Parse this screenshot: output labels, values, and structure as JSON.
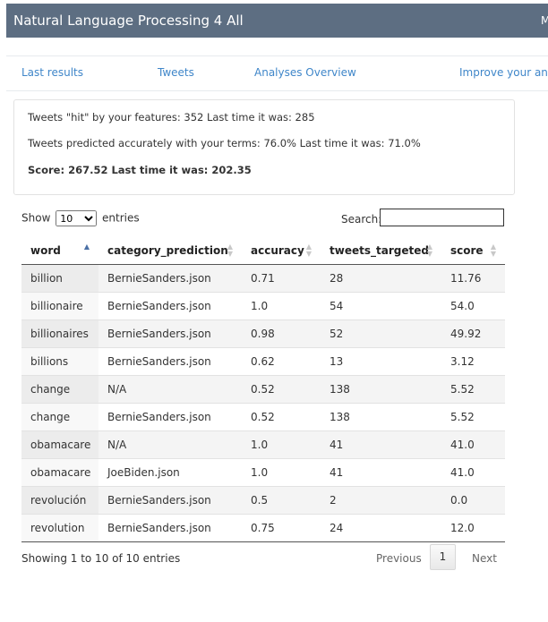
{
  "navbar": {
    "title": "Natural Language Processing 4 All",
    "extra": "M"
  },
  "tabs": [
    {
      "label": "Last results"
    },
    {
      "label": "Tweets"
    },
    {
      "label": "Analyses Overview"
    },
    {
      "label": "Improve your analy"
    }
  ],
  "summary": {
    "hit_line": "Tweets \"hit\" by your features: 352 Last time it was: 285",
    "accuracy_line": "Tweets predicted accurately with your terms: 76.0% Last time it was: 71.0%",
    "score_line": "Score: 267.52 Last time it was: 202.35"
  },
  "controls": {
    "show_label": "Show",
    "entries_value": "10",
    "entries_label": "entries",
    "search_label": "Search:",
    "search_value": ""
  },
  "table": {
    "columns": [
      "word",
      "category_prediction",
      "accuracy",
      "tweets_targeted",
      "score"
    ],
    "rows": [
      [
        "billion",
        "BernieSanders.json",
        "0.71",
        "28",
        "11.76"
      ],
      [
        "billionaire",
        "BernieSanders.json",
        "1.0",
        "54",
        "54.0"
      ],
      [
        "billionaires",
        "BernieSanders.json",
        "0.98",
        "52",
        "49.92"
      ],
      [
        "billions",
        "BernieSanders.json",
        "0.62",
        "13",
        "3.12"
      ],
      [
        "change",
        "N/A",
        "0.52",
        "138",
        "5.52"
      ],
      [
        "change",
        "BernieSanders.json",
        "0.52",
        "138",
        "5.52"
      ],
      [
        "obamacare",
        "N/A",
        "1.0",
        "41",
        "41.0"
      ],
      [
        "obamacare",
        "JoeBiden.json",
        "1.0",
        "41",
        "41.0"
      ],
      [
        "revolución",
        "BernieSanders.json",
        "0.5",
        "2",
        "0.0"
      ],
      [
        "revolution",
        "BernieSanders.json",
        "0.75",
        "24",
        "12.0"
      ]
    ]
  },
  "footer": {
    "info": "Showing 1 to 10 of 10 entries",
    "previous": "Previous",
    "current_page": "1",
    "next": "Next"
  }
}
